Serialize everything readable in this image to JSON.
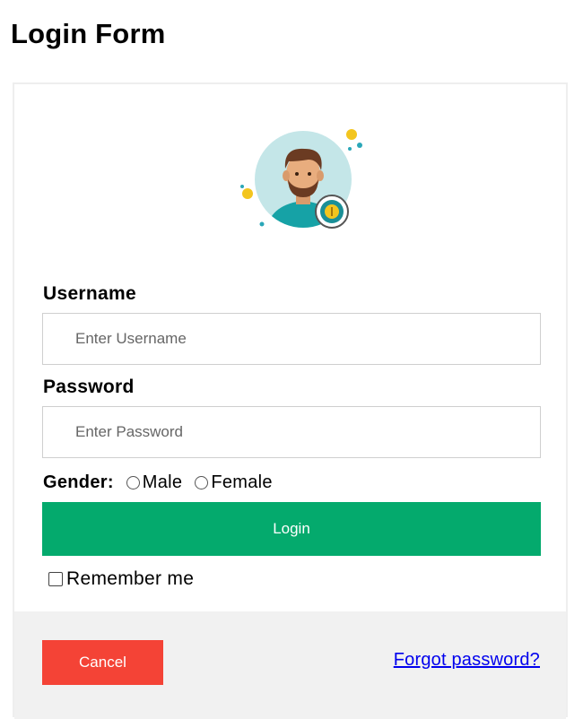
{
  "page": {
    "title": "Login Form"
  },
  "avatar": {
    "icon": "user-avatar-icon"
  },
  "form": {
    "username_label": "Username",
    "username_placeholder": "Enter Username",
    "username_value": "",
    "password_label": "Password",
    "password_placeholder": "Enter Password",
    "password_value": "",
    "gender_label": "Gender:",
    "gender_options": [
      "Male",
      "Female"
    ],
    "login_label": "Login",
    "remember_label": "Remember me",
    "remember_checked": false
  },
  "footer": {
    "cancel_label": "Cancel",
    "forgot_label": "Forgot password?"
  },
  "colors": {
    "login_button": "#04aa6d",
    "cancel_button": "#f44336",
    "link": "#0000ee",
    "footer_bg": "#f1f1f1"
  }
}
